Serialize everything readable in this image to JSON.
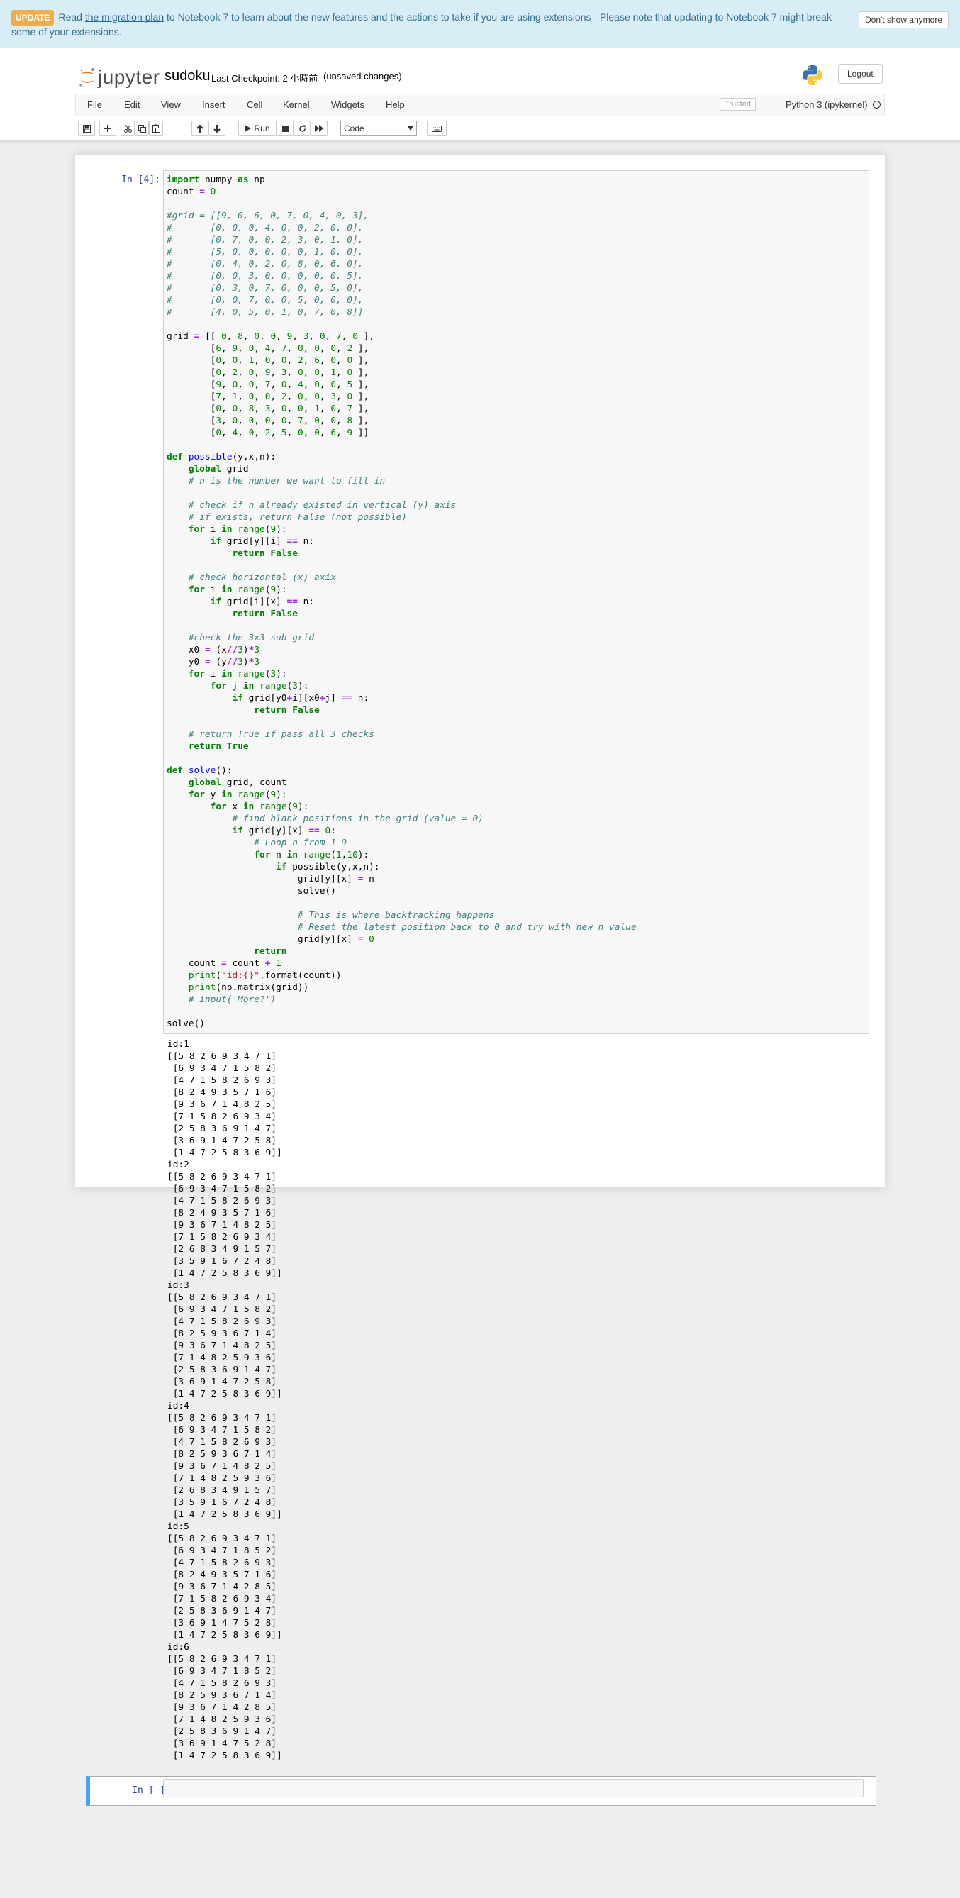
{
  "banner": {
    "badge": "UPDATE",
    "text_pre": "Read",
    "link": "the migration plan",
    "text_post": "to Notebook 7 to learn about the new features and the actions to take if you are using extensions - Please note that updating to Notebook 7 might break some of your extensions.",
    "dismiss_label": "Don't show anymore"
  },
  "header": {
    "logo_text": "jupyter",
    "notebook_name": "sudoku",
    "checkpoint": "Last Checkpoint: 2 小時前",
    "autosave": "(unsaved changes)",
    "logout_label": "Logout"
  },
  "menu": [
    "File",
    "Edit",
    "View",
    "Insert",
    "Cell",
    "Kernel",
    "Widgets",
    "Help"
  ],
  "trusted_label": "Trusted",
  "kernel_name": "Python 3 (ipykernel)",
  "toolbar": {
    "run_label": "Run",
    "cell_type": "Code",
    "icons": [
      "save-icon",
      "plus-icon",
      "cut-icon",
      "copy-icon",
      "paste-icon",
      "arrow-up-icon",
      "arrow-down-icon",
      "play-icon",
      "stop-icon",
      "restart-icon",
      "fast-forward-icon",
      "keyboard-icon"
    ]
  },
  "cells": [
    {
      "prompt": "In [4]:",
      "source": "import numpy as np\ncount = 0\n\n#grid = [[9, 0, 6, 0, 7, 0, 4, 0, 3],\n#       [0, 0, 0, 4, 0, 0, 2, 0, 0],\n#       [0, 7, 0, 0, 2, 3, 0, 1, 0],\n#       [5, 0, 0, 0, 0, 0, 1, 0, 0],\n#       [0, 4, 0, 2, 0, 8, 0, 6, 0],\n#       [0, 0, 3, 0, 0, 0, 0, 0, 5],\n#       [0, 3, 0, 7, 0, 0, 0, 5, 0],\n#       [0, 0, 7, 0, 0, 5, 0, 0, 0],\n#       [4, 0, 5, 0, 1, 0, 7, 0, 8]]\n\ngrid = [[ 0, 8, 0, 0, 9, 3, 0, 7, 0 ],\n        [6, 9, 0, 4, 7, 0, 0, 0, 2 ],\n        [0, 0, 1, 0, 0, 2, 6, 0, 0 ],\n        [0, 2, 0, 9, 3, 0, 0, 1, 0 ],\n        [9, 0, 0, 7, 0, 4, 0, 0, 5 ],\n        [7, 1, 0, 0, 2, 0, 0, 3, 0 ],\n        [0, 0, 8, 3, 0, 0, 1, 0, 7 ],\n        [3, 0, 0, 0, 0, 7, 0, 0, 8 ],\n        [0, 4, 0, 2, 5, 0, 0, 6, 9 ]]\n\ndef possible(y,x,n):\n    global grid\n    # n is the number we want to fill in\n\n    # check if n already existed in vertical (y) axis\n    # if exists, return False (not possible)\n    for i in range(9):\n        if grid[y][i] == n:\n            return False\n\n    # check horizontal (x) axix\n    for i in range(9):\n        if grid[i][x] == n:\n            return False\n\n    #check the 3x3 sub grid\n    x0 = (x//3)*3\n    y0 = (y//3)*3\n    for i in range(3):\n        for j in range(3):\n            if grid[y0+i][x0+j] == n:\n                return False\n\n    # return True if pass all 3 checks\n    return True\n\ndef solve():\n    global grid, count\n    for y in range(9):\n        for x in range(9):\n            # find blank positions in the grid (value = 0)\n            if grid[y][x] == 0:\n                # Loop n from 1-9\n                for n in range(1,10):\n                    if possible(y,x,n):\n                        grid[y][x] = n\n                        solve()\n\n                        # This is where backtracking happens\n                        # Reset the latest position back to 0 and try with new n value\n                        grid[y][x] = 0\n                return\n    count = count + 1\n    print(\"id:{}\".format(count))\n    print(np.matrix(grid))\n    # input('More?')\n\nsolve()",
      "output": "id:1\n[[5 8 2 6 9 3 4 7 1]\n [6 9 3 4 7 1 5 8 2]\n [4 7 1 5 8 2 6 9 3]\n [8 2 4 9 3 5 7 1 6]\n [9 3 6 7 1 4 8 2 5]\n [7 1 5 8 2 6 9 3 4]\n [2 5 8 3 6 9 1 4 7]\n [3 6 9 1 4 7 2 5 8]\n [1 4 7 2 5 8 3 6 9]]\nid:2\n[[5 8 2 6 9 3 4 7 1]\n [6 9 3 4 7 1 5 8 2]\n [4 7 1 5 8 2 6 9 3]\n [8 2 4 9 3 5 7 1 6]\n [9 3 6 7 1 4 8 2 5]\n [7 1 5 8 2 6 9 3 4]\n [2 6 8 3 4 9 1 5 7]\n [3 5 9 1 6 7 2 4 8]\n [1 4 7 2 5 8 3 6 9]]\nid:3\n[[5 8 2 6 9 3 4 7 1]\n [6 9 3 4 7 1 5 8 2]\n [4 7 1 5 8 2 6 9 3]\n [8 2 5 9 3 6 7 1 4]\n [9 3 6 7 1 4 8 2 5]\n [7 1 4 8 2 5 9 3 6]\n [2 5 8 3 6 9 1 4 7]\n [3 6 9 1 4 7 2 5 8]\n [1 4 7 2 5 8 3 6 9]]\nid:4\n[[5 8 2 6 9 3 4 7 1]\n [6 9 3 4 7 1 5 8 2]\n [4 7 1 5 8 2 6 9 3]\n [8 2 5 9 3 6 7 1 4]\n [9 3 6 7 1 4 8 2 5]\n [7 1 4 8 2 5 9 3 6]\n [2 6 8 3 4 9 1 5 7]\n [3 5 9 1 6 7 2 4 8]\n [1 4 7 2 5 8 3 6 9]]\nid:5\n[[5 8 2 6 9 3 4 7 1]\n [6 9 3 4 7 1 8 5 2]\n [4 7 1 5 8 2 6 9 3]\n [8 2 4 9 3 5 7 1 6]\n [9 3 6 7 1 4 2 8 5]\n [7 1 5 8 2 6 9 3 4]\n [2 5 8 3 6 9 1 4 7]\n [3 6 9 1 4 7 5 2 8]\n [1 4 7 2 5 8 3 6 9]]\nid:6\n[[5 8 2 6 9 3 4 7 1]\n [6 9 3 4 7 1 8 5 2]\n [4 7 1 5 8 2 6 9 3]\n [8 2 5 9 3 6 7 1 4]\n [9 3 6 7 1 4 2 8 5]\n [7 1 4 8 2 5 9 3 6]\n [2 5 8 3 6 9 1 4 7]\n [3 6 9 1 4 7 5 2 8]\n [1 4 7 2 5 8 3 6 9]]"
    },
    {
      "prompt": "In [ ]:",
      "source": ""
    }
  ]
}
